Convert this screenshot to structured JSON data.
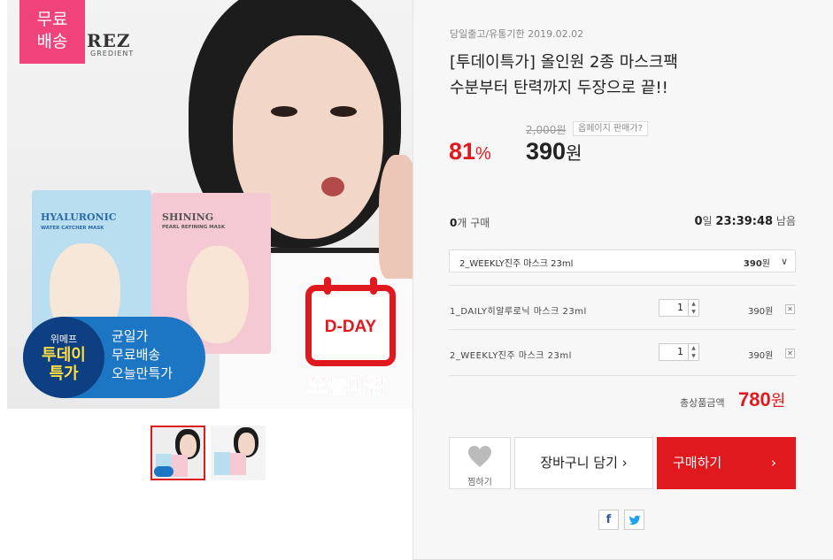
{
  "badge": {
    "free_shipping": "무료\n배송"
  },
  "hero": {
    "brand": "REZ",
    "brand_sub": "GREDIENT",
    "mask1": {
      "title": "HYALURONIC",
      "subtitle": "WATER CATCHER MASK"
    },
    "mask2": {
      "title": "SHINING",
      "subtitle": "PEARL REFINING MASK"
    },
    "promo": {
      "small": "위메프",
      "big": "투데이\n특가",
      "lines": [
        "균일가",
        "무료배송",
        "오늘만특가"
      ]
    },
    "dday": "D-DAY",
    "today_end": "오늘마감"
  },
  "product": {
    "shipping_info": "당일출고/유통기한 2019.02.02",
    "title_line1": "[투데이특가] 올인원 2종 마스크팩",
    "title_line2": "수분부터 탄력까지 두장으로 끝!!",
    "original_price": "2,000원",
    "compare_label": "옵페이지 판매가?",
    "discount_num": "81",
    "discount_unit": "%",
    "price_num": "390",
    "price_unit": "원"
  },
  "status": {
    "sold_count": "0",
    "sold_label": "개 구매",
    "remain_day": "0",
    "remain_day_unit": "일",
    "remain_time": "23:39:48",
    "remain_label": "남음"
  },
  "option_select": {
    "label": "2_WEEKLY진주 마스크 23ml",
    "price_num": "390",
    "price_unit": "원"
  },
  "items": [
    {
      "name": "1_DAILY히알루로닉 마스크 23ml",
      "qty": "1",
      "price": "390원"
    },
    {
      "name": "2_WEEKLY진주 마스크 23ml",
      "qty": "1",
      "price": "390원"
    }
  ],
  "total": {
    "label": "총상품금액",
    "num": "780",
    "unit": "원"
  },
  "buttons": {
    "like": "찜하기",
    "cart": "장바구니 담기",
    "buy": "구매하기"
  },
  "colors": {
    "accent": "#e0191e",
    "badge": "#f0437b",
    "panel_bg": "#f7f7f7"
  }
}
